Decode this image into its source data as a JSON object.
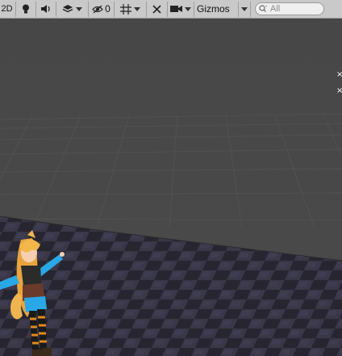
{
  "toolbar": {
    "mode_2d_label": "2D",
    "effects_count": "0",
    "gizmos_label": "Gizmos",
    "search_placeholder": "All",
    "icons": {
      "lighting": "lightbulb-icon",
      "audio": "speaker-icon",
      "effects": "layers-icon",
      "hidden": "eye-slash-icon",
      "grid": "grid-snap-icon",
      "tools": "tools-icon",
      "camera": "camera-icon",
      "search": "search-icon"
    }
  },
  "scene": {
    "background_color": "#474747",
    "floor_color": "#2c2a35",
    "grid_color": "#5a5a5a",
    "character": "anime-girl-avatar"
  },
  "colors": {
    "toolbar_bg": "#c9c9c9",
    "accent_blue": "#2aa7e6",
    "hair": "#f0b450"
  }
}
